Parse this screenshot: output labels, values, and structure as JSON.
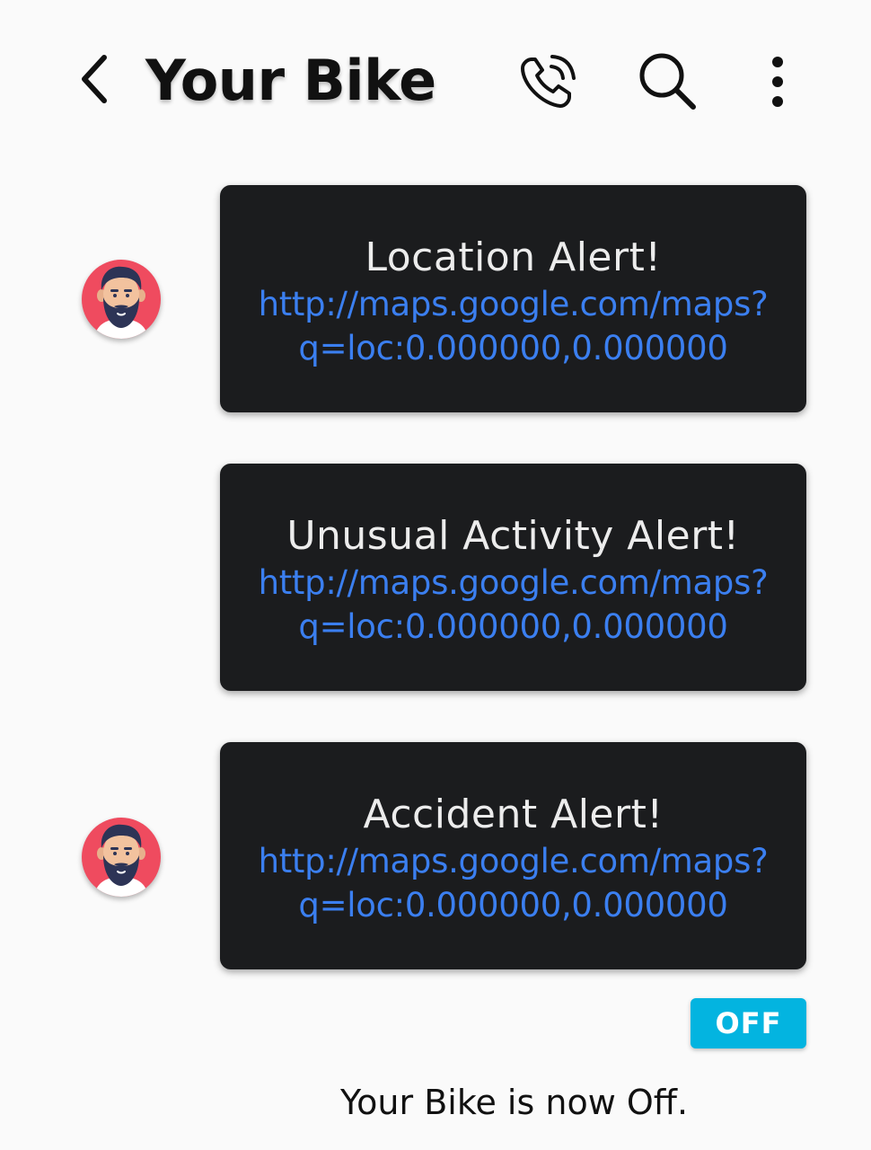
{
  "header": {
    "title": "Your Bike",
    "back_icon": "chevron-left-icon",
    "call_icon": "phone-call-icon",
    "search_icon": "search-icon",
    "more_icon": "more-vertical-icon"
  },
  "messages": [
    {
      "title": "Location Alert!",
      "link": "http://maps.google.com/maps?\nq=loc:0.000000,0.000000",
      "has_avatar": true
    },
    {
      "title": "Unusual Activity Alert!",
      "link": "http://maps.google.com/maps?\nq=loc:0.000000,0.000000",
      "has_avatar": false
    },
    {
      "title": "Accident Alert!",
      "link": "http://maps.google.com/maps?\nq=loc:0.000000,0.000000",
      "has_avatar": true
    }
  ],
  "status": {
    "chip_label": "OFF",
    "text": "Your Bike is now Off."
  },
  "colors": {
    "background": "#fafafa",
    "bubble": "#1b1c1e",
    "link": "#3b7ff0",
    "chip": "#03b4e0",
    "avatar_bg": "#ef4b5f"
  }
}
